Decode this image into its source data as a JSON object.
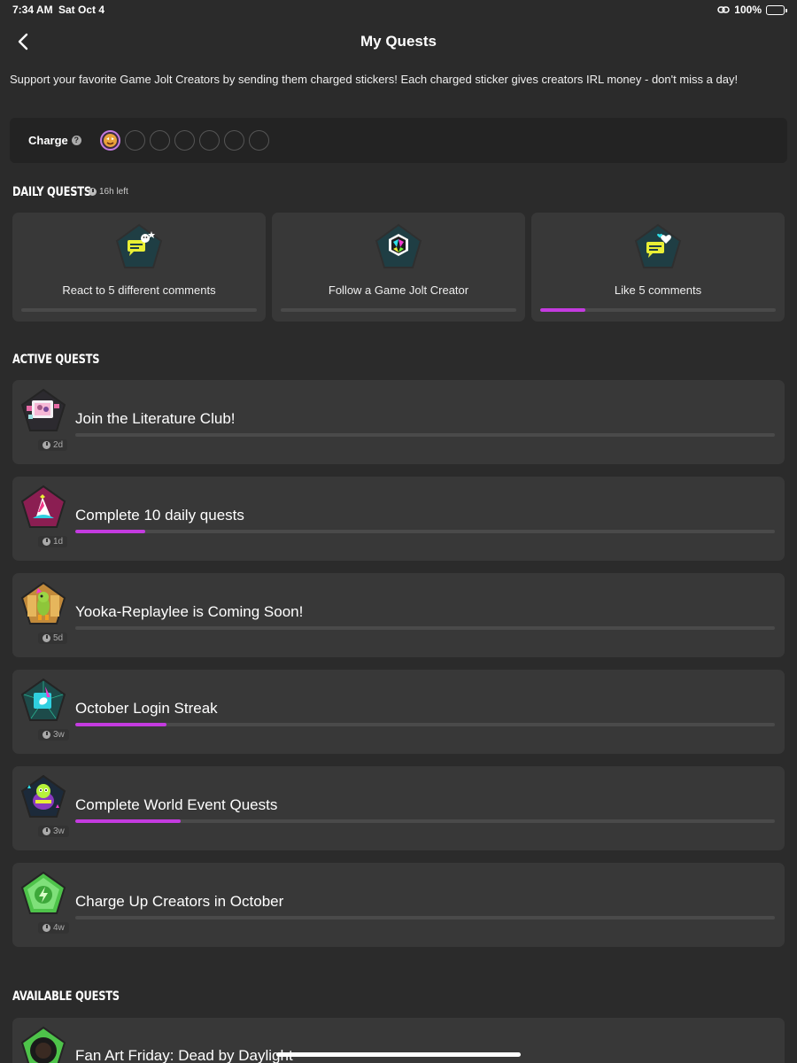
{
  "status": {
    "time": "7:34 AM",
    "date": "Sat Oct 4",
    "battery": "100%"
  },
  "nav": {
    "title": "My Quests"
  },
  "intro": "Support your favorite Game Jolt Creators by sending them charged stickers! Each charged sticker gives creators IRL money - don't miss a day!",
  "charge": {
    "label": "Charge",
    "filled": 1,
    "total": 7
  },
  "daily": {
    "title": "DAILY QUESTS",
    "time_left": "16h left",
    "items": [
      {
        "label": "React to 5 different comments",
        "progress": 0
      },
      {
        "label": "Follow a Game Jolt Creator",
        "progress": 0
      },
      {
        "label": "Like 5 comments",
        "progress": 0.19
      }
    ]
  },
  "active": {
    "title": "ACTIVE QUESTS",
    "items": [
      {
        "title": "Join the Literature Club!",
        "time": "2d",
        "progress": 0
      },
      {
        "title": "Complete 10 daily quests",
        "time": "1d",
        "progress": 0.1
      },
      {
        "title": "Yooka-Replaylee is Coming Soon!",
        "time": "5d",
        "progress": 0
      },
      {
        "title": "October Login Streak",
        "time": "3w",
        "progress": 0.13
      },
      {
        "title": "Complete World Event Quests",
        "time": "3w",
        "progress": 0.15
      },
      {
        "title": "Charge Up Creators in October",
        "time": "4w",
        "progress": 0
      }
    ]
  },
  "available": {
    "title": "AVAILABLE QUESTS",
    "items": [
      {
        "title": "Fan Art Friday: Dead by Daylight"
      }
    ]
  },
  "colors": {
    "background": "#2b2b2b",
    "card": "#383838",
    "progress": "#c43be0",
    "track": "#4a4a4a"
  }
}
